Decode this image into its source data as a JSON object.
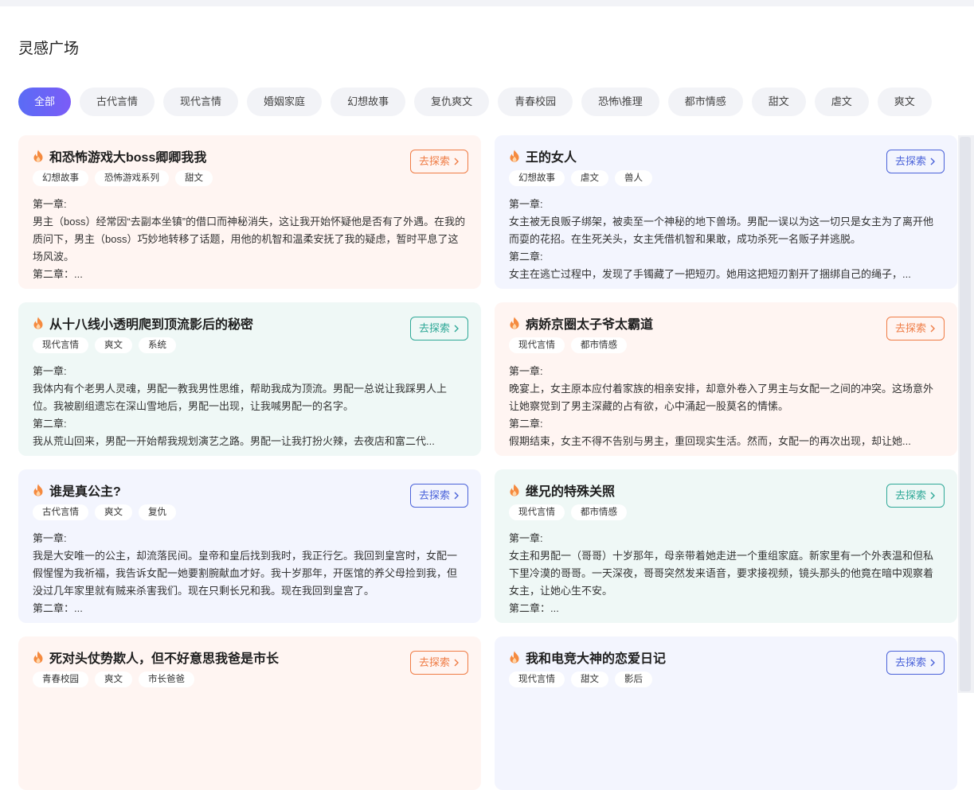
{
  "page": {
    "title": "灵感广场"
  },
  "categories": [
    {
      "label": "全部",
      "active": true
    },
    {
      "label": "古代言情"
    },
    {
      "label": "现代言情"
    },
    {
      "label": "婚姻家庭"
    },
    {
      "label": "幻想故事"
    },
    {
      "label": "复仇爽文"
    },
    {
      "label": "青春校园"
    },
    {
      "label": "恐怖\\推理"
    },
    {
      "label": "都市情感"
    },
    {
      "label": "甜文"
    },
    {
      "label": "虐文"
    },
    {
      "label": "爽文"
    }
  ],
  "explore_label": "去探索",
  "colors": {
    "orange": "#ef7c45",
    "blue": "#4a62d9",
    "teal": "#2ea897",
    "accent": "#5a6cf5"
  },
  "cards": [
    {
      "title": "和恐怖游戏大boss卿卿我我",
      "tags": [
        "幻想故事",
        "恐怖游戏系列",
        "甜文"
      ],
      "lines": [
        "第一章:",
        "男主（boss）经常因“去副本坐镇”的借口而神秘消失，这让我开始怀疑他是否有了外遇。在我的质问下，男主（boss）巧妙地转移了话题，用他的机智和温柔安抚了我的疑虑，暂时平息了这场风波。",
        "第二章：..."
      ]
    },
    {
      "title": "王的女人",
      "tags": [
        "幻想故事",
        "虐文",
        "兽人"
      ],
      "lines": [
        "第一章:",
        "女主被无良贩子绑架，被卖至一个神秘的地下兽场。男配一误以为这一切只是女主为了离开他而耍的花招。在生死关头，女主凭借机智和果敢，成功杀死一名贩子并逃脱。",
        "第二章:",
        "女主在逃亡过程中，发现了手镯藏了一把短刃。她用这把短刃割开了捆绑自己的绳子，..."
      ]
    },
    {
      "title": "从十八线小透明爬到顶流影后的秘密",
      "tags": [
        "现代言情",
        "爽文",
        "系统"
      ],
      "lines": [
        "第一章:",
        "我体内有个老男人灵魂，男配一教我男性思维，帮助我成为顶流。男配一总说让我踩男人上位。我被剧组遗忘在深山雪地后，男配一出现，让我喊男配一的名字。",
        "第二章:",
        "我从荒山回来，男配一开始帮我规划演艺之路。男配一让我打扮火辣，去夜店和富二代..."
      ]
    },
    {
      "title": "病娇京圈太子爷太霸道",
      "tags": [
        "现代言情",
        "都市情感"
      ],
      "lines": [
        "第一章:",
        "晚宴上，女主原本应付着家族的相亲安排，却意外卷入了男主与女配一之间的冲突。这场意外让她察觉到了男主深藏的占有欲，心中涌起一股莫名的情愫。",
        "第二章:",
        "假期结束，女主不得不告别与男主，重回现实生活。然而，女配一的再次出现，却让她..."
      ]
    },
    {
      "title": "谁是真公主?",
      "tags": [
        "古代言情",
        "爽文",
        "复仇"
      ],
      "lines": [
        "第一章:",
        "我是大安唯一的公主，却流落民间。皇帝和皇后找到我时，我正行乞。我回到皇宫时，女配一假惺惺为我祈福，我告诉女配一她要割腕献血才好。我十岁那年，开医馆的养父母捡到我，但没过几年家里就有贼来杀害我们。现在只剩长兄和我。现在我回到皇宫了。",
        "第二章：..."
      ]
    },
    {
      "title": "继兄的特殊关照",
      "tags": [
        "现代言情",
        "都市情感"
      ],
      "lines": [
        "第一章:",
        "女主和男配一（哥哥）十岁那年，母亲带着她走进一个重组家庭。新家里有一个外表温和但私下里冷漠的哥哥。一天深夜，哥哥突然发来语音，要求接视频，镜头那头的他竟在暗中观察着女主，让她心生不安。",
        "第二章：..."
      ]
    },
    {
      "title": "死对头仗势欺人，但不好意思我爸是市长",
      "tags": [
        "青春校园",
        "爽文",
        "市长爸爸"
      ],
      "lines": []
    },
    {
      "title": "我和电竞大神的恋爱日记",
      "tags": [
        "现代言情",
        "甜文",
        "影后"
      ],
      "lines": []
    }
  ]
}
